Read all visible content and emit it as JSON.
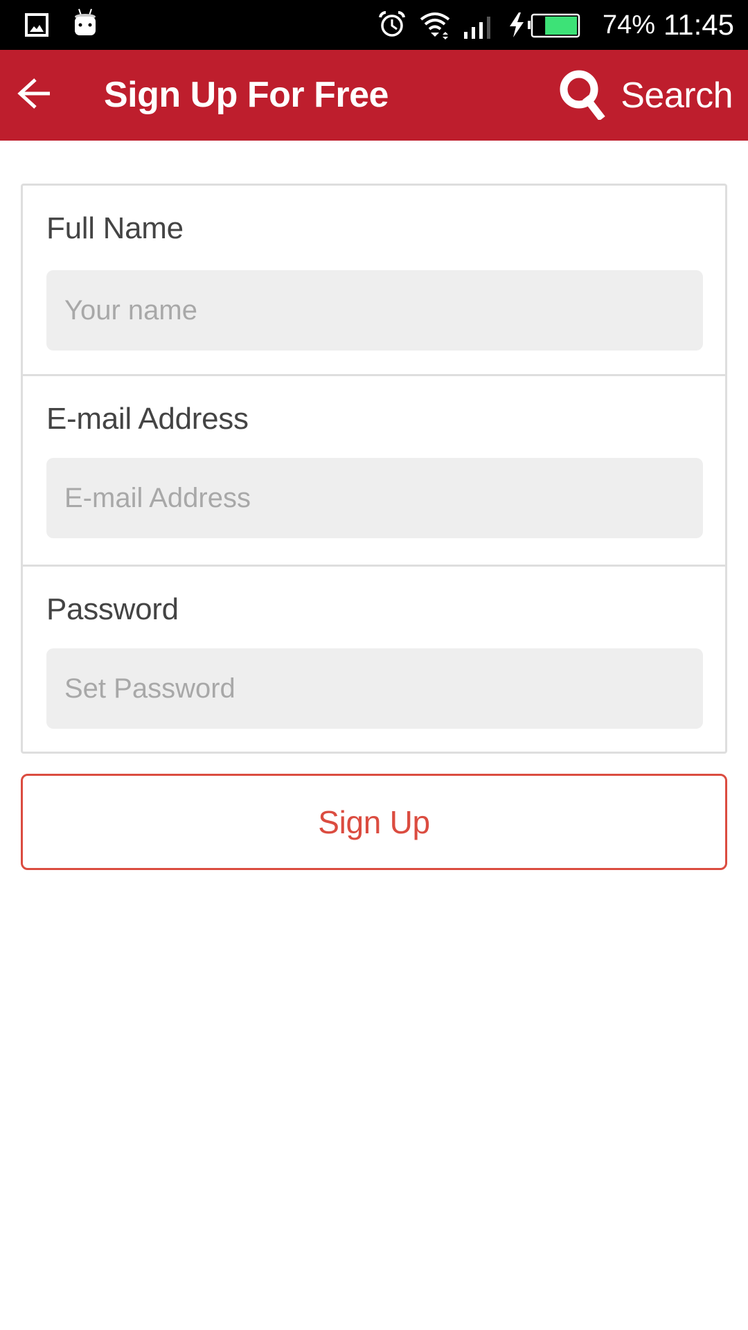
{
  "status_bar": {
    "left_icons": [
      "gallery-icon",
      "android-icon"
    ],
    "right_icons": [
      "alarm-icon",
      "wifi-icon",
      "cell-signal-icon",
      "charging-icon",
      "battery-icon"
    ],
    "battery_percent_text": "74%",
    "battery_level": 0.74,
    "time": "11:45",
    "battery_color": "#3DE277"
  },
  "app_bar": {
    "title": "Sign Up For Free",
    "back_icon": "arrow-left-icon",
    "search_icon": "search-icon",
    "search_label": "Search",
    "background_color": "#BE1E2D"
  },
  "form": {
    "fields": [
      {
        "label": "Full Name",
        "placeholder": "Your name",
        "value": "",
        "type": "text"
      },
      {
        "label": "E-mail Address",
        "placeholder": "E-mail Address",
        "value": "",
        "type": "email"
      },
      {
        "label": "Password",
        "placeholder": "Set Password",
        "value": "",
        "type": "password"
      }
    ],
    "submit_label": "Sign Up",
    "accent_color": "#DB4C40"
  }
}
